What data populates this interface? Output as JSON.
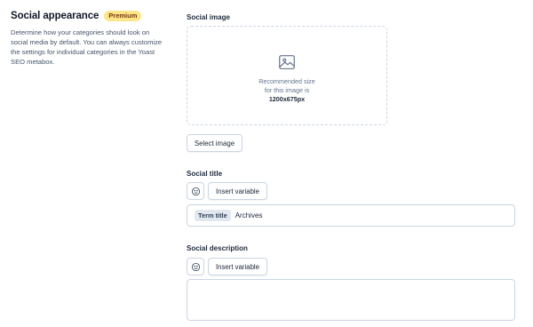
{
  "section": {
    "title": "Social appearance",
    "badge": "Premium",
    "description": "Determine how your categories should look on social media by default. You can always customize the settings for individual categories in the Yoast SEO metabox."
  },
  "social_image": {
    "label": "Social image",
    "dropzone_line1": "Recommended size",
    "dropzone_line2": "for this image is",
    "dropzone_size": "1200x675px",
    "icon": "image-icon",
    "button_label": "Select image"
  },
  "social_title": {
    "label": "Social title",
    "emoji_icon": "smiley-icon",
    "insert_variable_label": "Insert variable",
    "chip": "Term title",
    "value": "Archives"
  },
  "social_description": {
    "label": "Social description",
    "emoji_icon": "smiley-icon",
    "insert_variable_label": "Insert variable",
    "value": ""
  },
  "colors": {
    "badge_bg": "#fde68a",
    "border": "#cbd5e1",
    "chip_bg": "#e2e8f0"
  }
}
